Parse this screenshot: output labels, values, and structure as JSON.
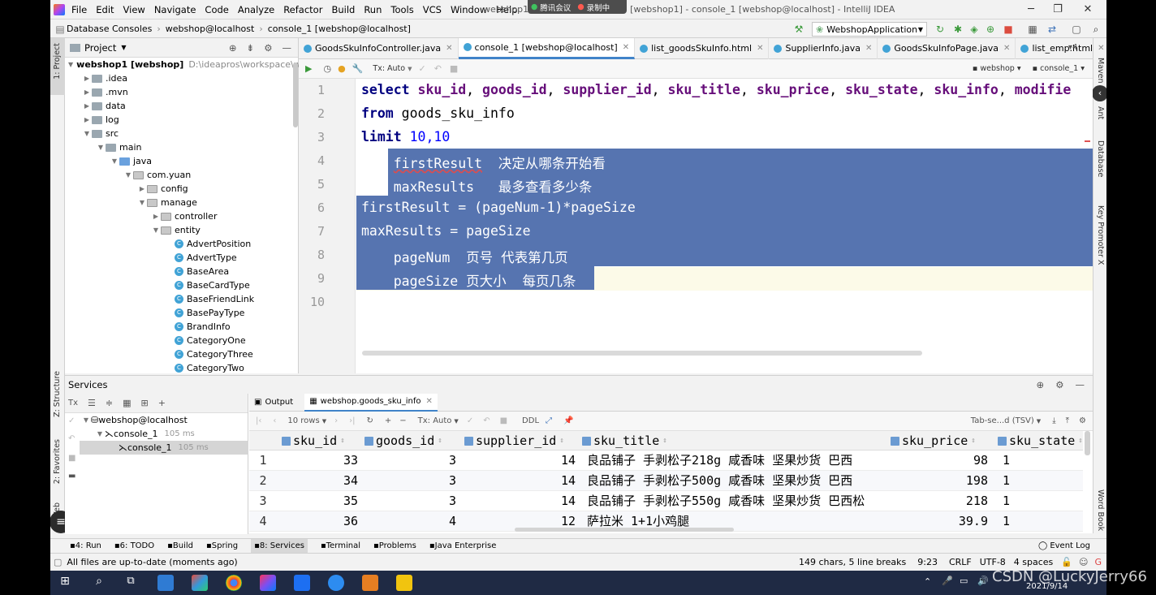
{
  "menu": {
    "items": [
      "File",
      "Edit",
      "View",
      "Navigate",
      "Code",
      "Analyze",
      "Refactor",
      "Build",
      "Run",
      "Tools",
      "VCS",
      "Window",
      "Help"
    ],
    "title_prefix": "webshop1",
    "title_suffix": "[webshop1] - console_1 [webshop@localhost] - IntelliJ IDEA",
    "meeting_label": "腾讯会议",
    "recording_label": "录制中"
  },
  "nav": {
    "crumbs": [
      "Database Consoles",
      "webshop@localhost",
      "console_1 [webshop@localhost]"
    ],
    "run_config": "WebshopApplication"
  },
  "left_strip": {
    "project": "1: Project",
    "structure": "Z: Structure",
    "favorites": "2: Favorites",
    "web": "Web"
  },
  "right_strip": {
    "maven": "Maven",
    "ant": "Ant",
    "database": "Database",
    "key_promoter": "Key Promoter X",
    "word_book": "Word Book"
  },
  "project": {
    "title": "Project",
    "tree": [
      {
        "label": "webshop1 [webshop]",
        "extra": "D:\\ideapros\\workspace\\web",
        "depth": 0,
        "type": "module",
        "open": true
      },
      {
        "label": ".idea",
        "depth": 1,
        "type": "folder",
        "open": false
      },
      {
        "label": ".mvn",
        "depth": 1,
        "type": "folder",
        "open": false
      },
      {
        "label": "data",
        "depth": 1,
        "type": "folder",
        "open": false
      },
      {
        "label": "log",
        "depth": 1,
        "type": "folder",
        "open": false
      },
      {
        "label": "src",
        "depth": 1,
        "type": "folder",
        "open": true
      },
      {
        "label": "main",
        "depth": 2,
        "type": "folder",
        "open": true
      },
      {
        "label": "java",
        "depth": 3,
        "type": "src",
        "open": true
      },
      {
        "label": "com.yuan",
        "depth": 4,
        "type": "pkg",
        "open": true
      },
      {
        "label": "config",
        "depth": 5,
        "type": "pkg",
        "open": false
      },
      {
        "label": "manage",
        "depth": 5,
        "type": "pkg",
        "open": true
      },
      {
        "label": "controller",
        "depth": 6,
        "type": "pkg",
        "open": false
      },
      {
        "label": "entity",
        "depth": 6,
        "type": "pkg",
        "open": true
      },
      {
        "label": "AdvertPosition",
        "depth": 7,
        "type": "class"
      },
      {
        "label": "AdvertType",
        "depth": 7,
        "type": "class"
      },
      {
        "label": "BaseArea",
        "depth": 7,
        "type": "class"
      },
      {
        "label": "BaseCardType",
        "depth": 7,
        "type": "class"
      },
      {
        "label": "BaseFriendLink",
        "depth": 7,
        "type": "class"
      },
      {
        "label": "BasePayType",
        "depth": 7,
        "type": "class"
      },
      {
        "label": "BrandInfo",
        "depth": 7,
        "type": "class"
      },
      {
        "label": "CategoryOne",
        "depth": 7,
        "type": "class"
      },
      {
        "label": "CategoryThree",
        "depth": 7,
        "type": "class"
      },
      {
        "label": "CategoryTwo",
        "depth": 7,
        "type": "class"
      }
    ]
  },
  "editor": {
    "tabs": [
      {
        "label": "GoodsSkuInfoController.java",
        "active": false
      },
      {
        "label": "console_1 [webshop@localhost]",
        "active": true
      },
      {
        "label": "list_goodsSkuInfo.html",
        "active": false
      },
      {
        "label": "SupplierInfo.java",
        "active": false
      },
      {
        "label": "GoodsSkuInfoPage.java",
        "active": false
      },
      {
        "label": "list_emp.html",
        "active": false
      }
    ],
    "tabs_overflow": "4",
    "tx_mode": "Tx: Auto",
    "schema": "webshop",
    "console": "console_1",
    "line_numbers": [
      "1",
      "2",
      "3",
      "4",
      "5",
      "6",
      "7",
      "8",
      "9",
      "10"
    ],
    "lines": {
      "l1_kw": "select",
      "l1_cols": [
        "sku_id",
        "goods_id",
        "supplier_id",
        "sku_title",
        "sku_price",
        "sku_state",
        "sku_info",
        "modifie"
      ],
      "l2_kw": "from",
      "l2_rest": " goods_sku_info",
      "l3_kw": "limit",
      "l3_num": " 10,10",
      "l4a": "firstResult",
      "l4b": "  决定从哪条开始看",
      "l5": "    maxResults   最多查看多少条",
      "l6": "firstResult = (pageNum-1)*pageSize",
      "l7": "maxResults = pageSize",
      "l8": "    pageNum  页号 代表第几页",
      "l9": "    pageSize 页大小  每页几条"
    }
  },
  "services": {
    "title": "Services",
    "tree": [
      {
        "label": "webshop@localhost",
        "time": "",
        "depth": 0
      },
      {
        "label": "console_1",
        "time": "105 ms",
        "depth": 1
      },
      {
        "label": "console_1",
        "time": "105 ms",
        "depth": 2
      }
    ],
    "result_tabs": [
      "Output",
      "webshop.goods_sku_info"
    ],
    "rows_select": "10 rows",
    "tx_mode": "Tx: Auto",
    "ddl": "DDL",
    "format": "Tab-se...d (TSV)",
    "columns": [
      "sku_id",
      "goods_id",
      "supplier_id",
      "sku_title",
      "sku_price",
      "sku_state"
    ],
    "rows": [
      {
        "n": "1",
        "sku_id": "33",
        "goods_id": "3",
        "supplier_id": "14",
        "sku_title": "良品铺子 手剥松子218g 咸香味  坚果炒货 巴西",
        "sku_price": "98",
        "sku_state": "1"
      },
      {
        "n": "2",
        "sku_id": "34",
        "goods_id": "3",
        "supplier_id": "14",
        "sku_title": "良品铺子 手剥松子500g 咸香味  坚果炒货 巴西",
        "sku_price": "198",
        "sku_state": "1"
      },
      {
        "n": "3",
        "sku_id": "35",
        "goods_id": "3",
        "supplier_id": "14",
        "sku_title": "良品铺子 手剥松子550g 咸香味 坚果炒货 巴西松",
        "sku_price": "218",
        "sku_state": "1"
      },
      {
        "n": "4",
        "sku_id": "36",
        "goods_id": "4",
        "supplier_id": "12",
        "sku_title": "萨拉米 1+1小鸡腿",
        "sku_price": "39.9",
        "sku_state": "1"
      }
    ]
  },
  "tool_windows": [
    {
      "label": "4: Run",
      "active": false
    },
    {
      "label": "6: TODO",
      "active": false
    },
    {
      "label": "Build",
      "active": false
    },
    {
      "label": "Spring",
      "active": false
    },
    {
      "label": "8: Services",
      "active": true
    },
    {
      "label": "Terminal",
      "active": false
    },
    {
      "label": "Problems",
      "active": false
    },
    {
      "label": "Java Enterprise",
      "active": false
    }
  ],
  "event_log": "Event Log",
  "status": {
    "message": "All files are up-to-date (moments ago)",
    "chars": "149 chars, 5 line breaks",
    "position": "9:23",
    "line_sep": "CRLF",
    "encoding": "UTF-8",
    "indent": "4 spaces"
  },
  "taskbar": {
    "watermark": "CSDN @LuckyJerry66",
    "date": "2021/9/14"
  },
  "colors": {
    "selection": "#5674b0",
    "keyword": "#000080",
    "identifier": "#660e7a",
    "number": "#0000ff",
    "accent": "#4083c9"
  }
}
